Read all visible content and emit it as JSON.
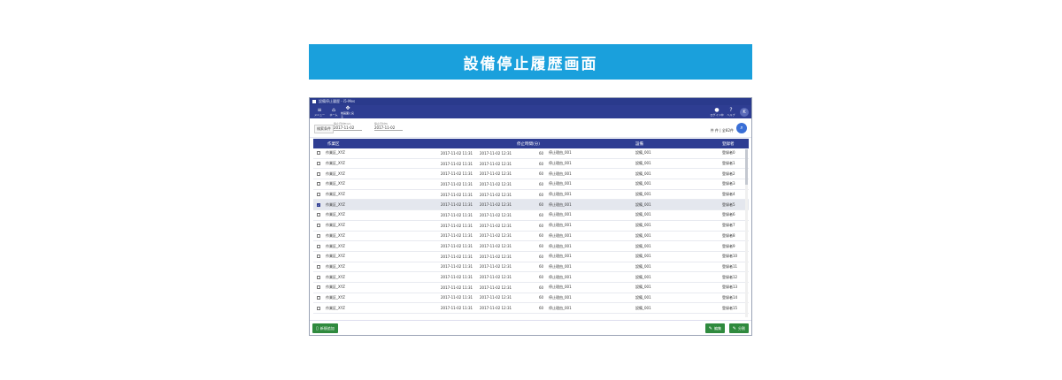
{
  "banner": {
    "title": "設備停止履歴画面"
  },
  "window": {
    "title": "設備停止履歴 - i5-Mes"
  },
  "toolbar": {
    "menu": "メニュー",
    "home": "ホーム",
    "history": "前画面に戻る",
    "user": "ログイン中",
    "help": "ヘルプ",
    "avatar_letter": "K"
  },
  "filter": {
    "label": "検索条件",
    "from_caption": "停止日付From",
    "from_value": "2017-11-02",
    "to_caption": "停止日付To",
    "to_value": "2017-11-02",
    "count": "件 件 | 全82件"
  },
  "table": {
    "headers": {
      "area": "作業区",
      "duration": "停止時間(分)",
      "equipment": "設備",
      "registrant": "登録者"
    },
    "rows": [
      {
        "area": "作業区_XYZ",
        "start": "2017-11-02 11:31",
        "end": "2017-11-02 12:31",
        "minutes": "60",
        "reason": "停止理由_001",
        "equipment": "設備_001",
        "registrant": "登録者0",
        "checked": false
      },
      {
        "area": "作業区_XYZ",
        "start": "2017-11-02 11:31",
        "end": "2017-11-02 12:31",
        "minutes": "60",
        "reason": "停止理由_001",
        "equipment": "設備_001",
        "registrant": "登録者1",
        "checked": false
      },
      {
        "area": "作業区_XYZ",
        "start": "2017-11-02 11:31",
        "end": "2017-11-02 12:31",
        "minutes": "60",
        "reason": "停止理由_001",
        "equipment": "設備_001",
        "registrant": "登録者2",
        "checked": false
      },
      {
        "area": "作業区_XYZ",
        "start": "2017-11-02 11:31",
        "end": "2017-11-02 12:31",
        "minutes": "60",
        "reason": "停止理由_001",
        "equipment": "設備_001",
        "registrant": "登録者3",
        "checked": false
      },
      {
        "area": "作業区_XYZ",
        "start": "2017-11-02 11:31",
        "end": "2017-11-02 12:31",
        "minutes": "60",
        "reason": "停止理由_001",
        "equipment": "設備_001",
        "registrant": "登録者4",
        "checked": false
      },
      {
        "area": "作業区_XYZ",
        "start": "2017-11-02 11:31",
        "end": "2017-11-02 12:31",
        "minutes": "60",
        "reason": "停止理由_001",
        "equipment": "設備_001",
        "registrant": "登録者5",
        "checked": true
      },
      {
        "area": "作業区_XYZ",
        "start": "2017-11-02 11:31",
        "end": "2017-11-02 12:31",
        "minutes": "60",
        "reason": "停止理由_001",
        "equipment": "設備_001",
        "registrant": "登録者6",
        "checked": false
      },
      {
        "area": "作業区_XYZ",
        "start": "2017-11-02 11:31",
        "end": "2017-11-02 12:31",
        "minutes": "60",
        "reason": "停止理由_001",
        "equipment": "設備_001",
        "registrant": "登録者7",
        "checked": false
      },
      {
        "area": "作業区_XYZ",
        "start": "2017-11-02 11:31",
        "end": "2017-11-02 12:31",
        "minutes": "60",
        "reason": "停止理由_001",
        "equipment": "設備_001",
        "registrant": "登録者8",
        "checked": false
      },
      {
        "area": "作業区_XYZ",
        "start": "2017-11-02 11:31",
        "end": "2017-11-02 12:31",
        "minutes": "60",
        "reason": "停止理由_001",
        "equipment": "設備_001",
        "registrant": "登録者9",
        "checked": false
      },
      {
        "area": "作業区_XYZ",
        "start": "2017-11-02 11:31",
        "end": "2017-11-02 12:31",
        "minutes": "60",
        "reason": "停止理由_001",
        "equipment": "設備_001",
        "registrant": "登録者10",
        "checked": false
      },
      {
        "area": "作業区_XYZ",
        "start": "2017-11-02 11:31",
        "end": "2017-11-02 12:31",
        "minutes": "60",
        "reason": "停止理由_001",
        "equipment": "設備_001",
        "registrant": "登録者11",
        "checked": false
      },
      {
        "area": "作業区_XYZ",
        "start": "2017-11-02 11:31",
        "end": "2017-11-02 12:31",
        "minutes": "60",
        "reason": "停止理由_001",
        "equipment": "設備_001",
        "registrant": "登録者12",
        "checked": false
      },
      {
        "area": "作業区_XYZ",
        "start": "2017-11-02 11:31",
        "end": "2017-11-02 12:31",
        "minutes": "60",
        "reason": "停止理由_001",
        "equipment": "設備_001",
        "registrant": "登録者13",
        "checked": false
      },
      {
        "area": "作業区_XYZ",
        "start": "2017-11-02 11:31",
        "end": "2017-11-02 12:31",
        "minutes": "60",
        "reason": "停止理由_001",
        "equipment": "設備_001",
        "registrant": "登録者14",
        "checked": false
      },
      {
        "area": "作業区_XYZ",
        "start": "2017-11-02 11:31",
        "end": "2017-11-02 12:31",
        "minutes": "60",
        "reason": "停止理由_001",
        "equipment": "設備_001",
        "registrant": "登録者15",
        "checked": false
      }
    ]
  },
  "footer": {
    "add_label": "新規追加",
    "edit_label": "編集",
    "split_label": "分割"
  },
  "colors": {
    "banner": "#1aa0dc",
    "header": "#2e3d92",
    "button": "#2f8a3e"
  }
}
